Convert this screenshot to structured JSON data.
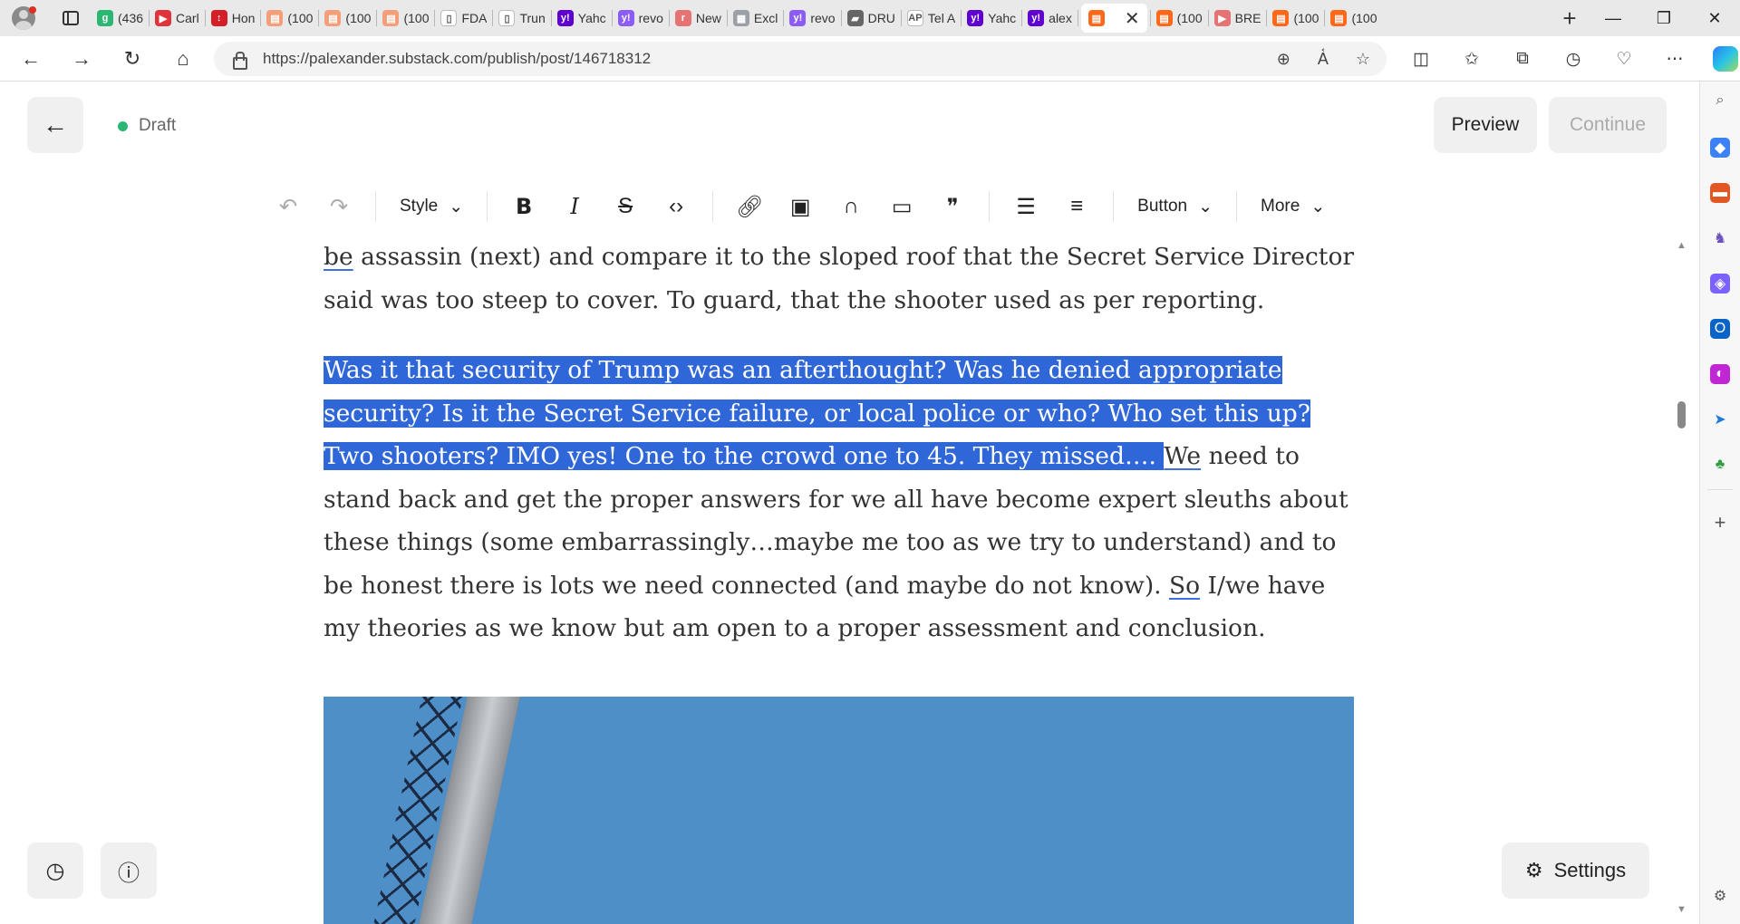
{
  "browser": {
    "tabs": [
      {
        "title": "(436",
        "icon_color": "#2bb673",
        "icon_char": "g"
      },
      {
        "title": "Carl",
        "icon_color": "#e0343c",
        "icon_char": "▶"
      },
      {
        "title": "Hon",
        "icon_color": "#d51f26",
        "icon_char": "↕"
      },
      {
        "title": "(100",
        "icon_color": "#f3a07a",
        "icon_char": "▤"
      },
      {
        "title": "(100",
        "icon_color": "#f3a07a",
        "icon_char": "▤"
      },
      {
        "title": "(100",
        "icon_color": "#f3a07a",
        "icon_char": "▤"
      },
      {
        "title": "FDA",
        "icon_color": "#ffffff",
        "icon_char": "▯"
      },
      {
        "title": "Trun",
        "icon_color": "#ffffff",
        "icon_char": "▯"
      },
      {
        "title": "Yahc",
        "icon_color": "#5f01d1",
        "icon_char": "y!"
      },
      {
        "title": "revo",
        "icon_color": "#8b5cf6",
        "icon_char": "y!"
      },
      {
        "title": "New",
        "icon_color": "#e57373",
        "icon_char": "r"
      },
      {
        "title": "Excl",
        "icon_color": "#9aa0a6",
        "icon_char": "▦"
      },
      {
        "title": "revo",
        "icon_color": "#8b5cf6",
        "icon_char": "y!"
      },
      {
        "title": "DRU",
        "icon_color": "#666666",
        "icon_char": "▰"
      },
      {
        "title": "Tel A",
        "icon_color": "#ffffff",
        "icon_char": "AP"
      },
      {
        "title": "Yahc",
        "icon_color": "#5f01d1",
        "icon_char": "y!"
      },
      {
        "title": "alex",
        "icon_color": "#5f01d1",
        "icon_char": "y!"
      }
    ],
    "active_tab": {
      "title": "",
      "icon_color": "#ff6719",
      "icon_char": "▤",
      "close": "✕"
    },
    "tabs_after": [
      {
        "title": "(100",
        "icon_color": "#ff6719",
        "icon_char": "▤"
      },
      {
        "title": "BRE",
        "icon_color": "#e57373",
        "icon_char": "▶"
      },
      {
        "title": "(100",
        "icon_color": "#ff6719",
        "icon_char": "▤"
      },
      {
        "title": "(100",
        "icon_color": "#ff6719",
        "icon_char": "▤"
      }
    ],
    "url": "https://palexander.substack.com/publish/post/146718312"
  },
  "editor": {
    "status": "Draft",
    "preview_label": "Preview",
    "continue_label": "Continue",
    "toolbar": {
      "style_label": "Style",
      "button_label": "Button",
      "more_label": "More"
    },
    "para1": {
      "word_underlined": "be",
      "text": " assassin (next) and compare it to the sloped roof that the Secret Service Director said was too steep to cover. To guard, that the shooter used as per reporting."
    },
    "para2": {
      "selected": "Was it that security of Trump was an afterthought? Was he denied appropriate security? Is it the Secret Service failure, or local police or who? Who set this up? Two shooters? IMO yes! One to the crowd one to 45. They missed…. ",
      "underlined_we": "We",
      "text_a": " need to stand back and get the proper answers for we all have become expert sleuths about these things (some embarrassingly…maybe me too as we try to understand) and to be honest there is lots we need connected (and maybe do not know). ",
      "underlined_so": "So",
      "text_b": " I/we have my theories as we know but am open to a proper assessment and conclusion."
    },
    "settings_label": "Settings"
  }
}
